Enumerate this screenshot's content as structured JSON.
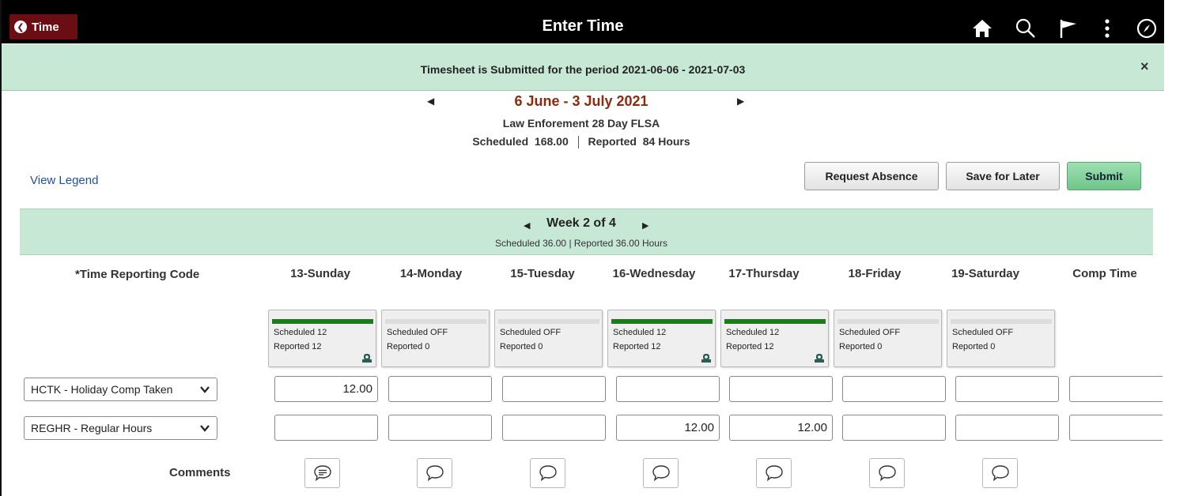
{
  "header": {
    "back_label": "Time",
    "title": "Enter Time",
    "icons": [
      "home-icon",
      "search-icon",
      "flag-icon",
      "more-vertical-icon",
      "compass-icon"
    ]
  },
  "banner": {
    "message": "Timesheet is Submitted for the period 2021-06-06 - 2021-07-03",
    "close_glyph": "×"
  },
  "period": {
    "title": "6 June - 3 July 2021",
    "schedule_name": "Law Enforement 28 Day FLSA",
    "scheduled_label": "Scheduled",
    "scheduled_value": "168.00",
    "reported_label": "Reported",
    "reported_value": "84 Hours"
  },
  "legend_link": "View Legend",
  "actions": {
    "request_absence": "Request Absence",
    "save_for_later": "Save for Later",
    "submit": "Submit"
  },
  "week": {
    "title": "Week 2 of 4",
    "summary": "Scheduled  36.00 | Reported  36.00 Hours"
  },
  "columns": {
    "trc_header": "*Time Reporting Code",
    "days": [
      "13-Sunday",
      "14-Monday",
      "15-Tuesday",
      "16-Wednesday",
      "17-Thursday",
      "18-Friday",
      "19-Saturday"
    ],
    "comp_time": "Comp Time"
  },
  "day_cards": [
    {
      "scheduled": "Scheduled 12",
      "reported": "Reported  12",
      "bar_on": true,
      "has_icon": true
    },
    {
      "scheduled": "Scheduled OFF",
      "reported": "Reported  0",
      "bar_on": false,
      "has_icon": false
    },
    {
      "scheduled": "Scheduled OFF",
      "reported": "Reported  0",
      "bar_on": false,
      "has_icon": false
    },
    {
      "scheduled": "Scheduled 12",
      "reported": "Reported  12",
      "bar_on": true,
      "has_icon": true
    },
    {
      "scheduled": "Scheduled 12",
      "reported": "Reported  12",
      "bar_on": true,
      "has_icon": true
    },
    {
      "scheduled": "Scheduled OFF",
      "reported": "Reported  0",
      "bar_on": false,
      "has_icon": false
    },
    {
      "scheduled": "Scheduled OFF",
      "reported": "Reported  0",
      "bar_on": false,
      "has_icon": false
    }
  ],
  "rows": [
    {
      "trc": "HCTK - Holiday Comp Taken",
      "values": [
        "12.00",
        "",
        "",
        "",
        "",
        "",
        "",
        ""
      ]
    },
    {
      "trc": "REGHR - Regular Hours",
      "values": [
        "",
        "",
        "",
        "12.00",
        "12.00",
        "",
        "",
        ""
      ]
    }
  ],
  "comments_label": "Comments",
  "colors": {
    "header_bg": "#000000",
    "back_button": "#6b0e14",
    "banner_bg": "#c8e8d6",
    "period_title": "#8b2a0e",
    "link": "#1f4fa5",
    "scheduled_bar": "#1d7a1d",
    "submit_bg": "#6fc58a"
  }
}
